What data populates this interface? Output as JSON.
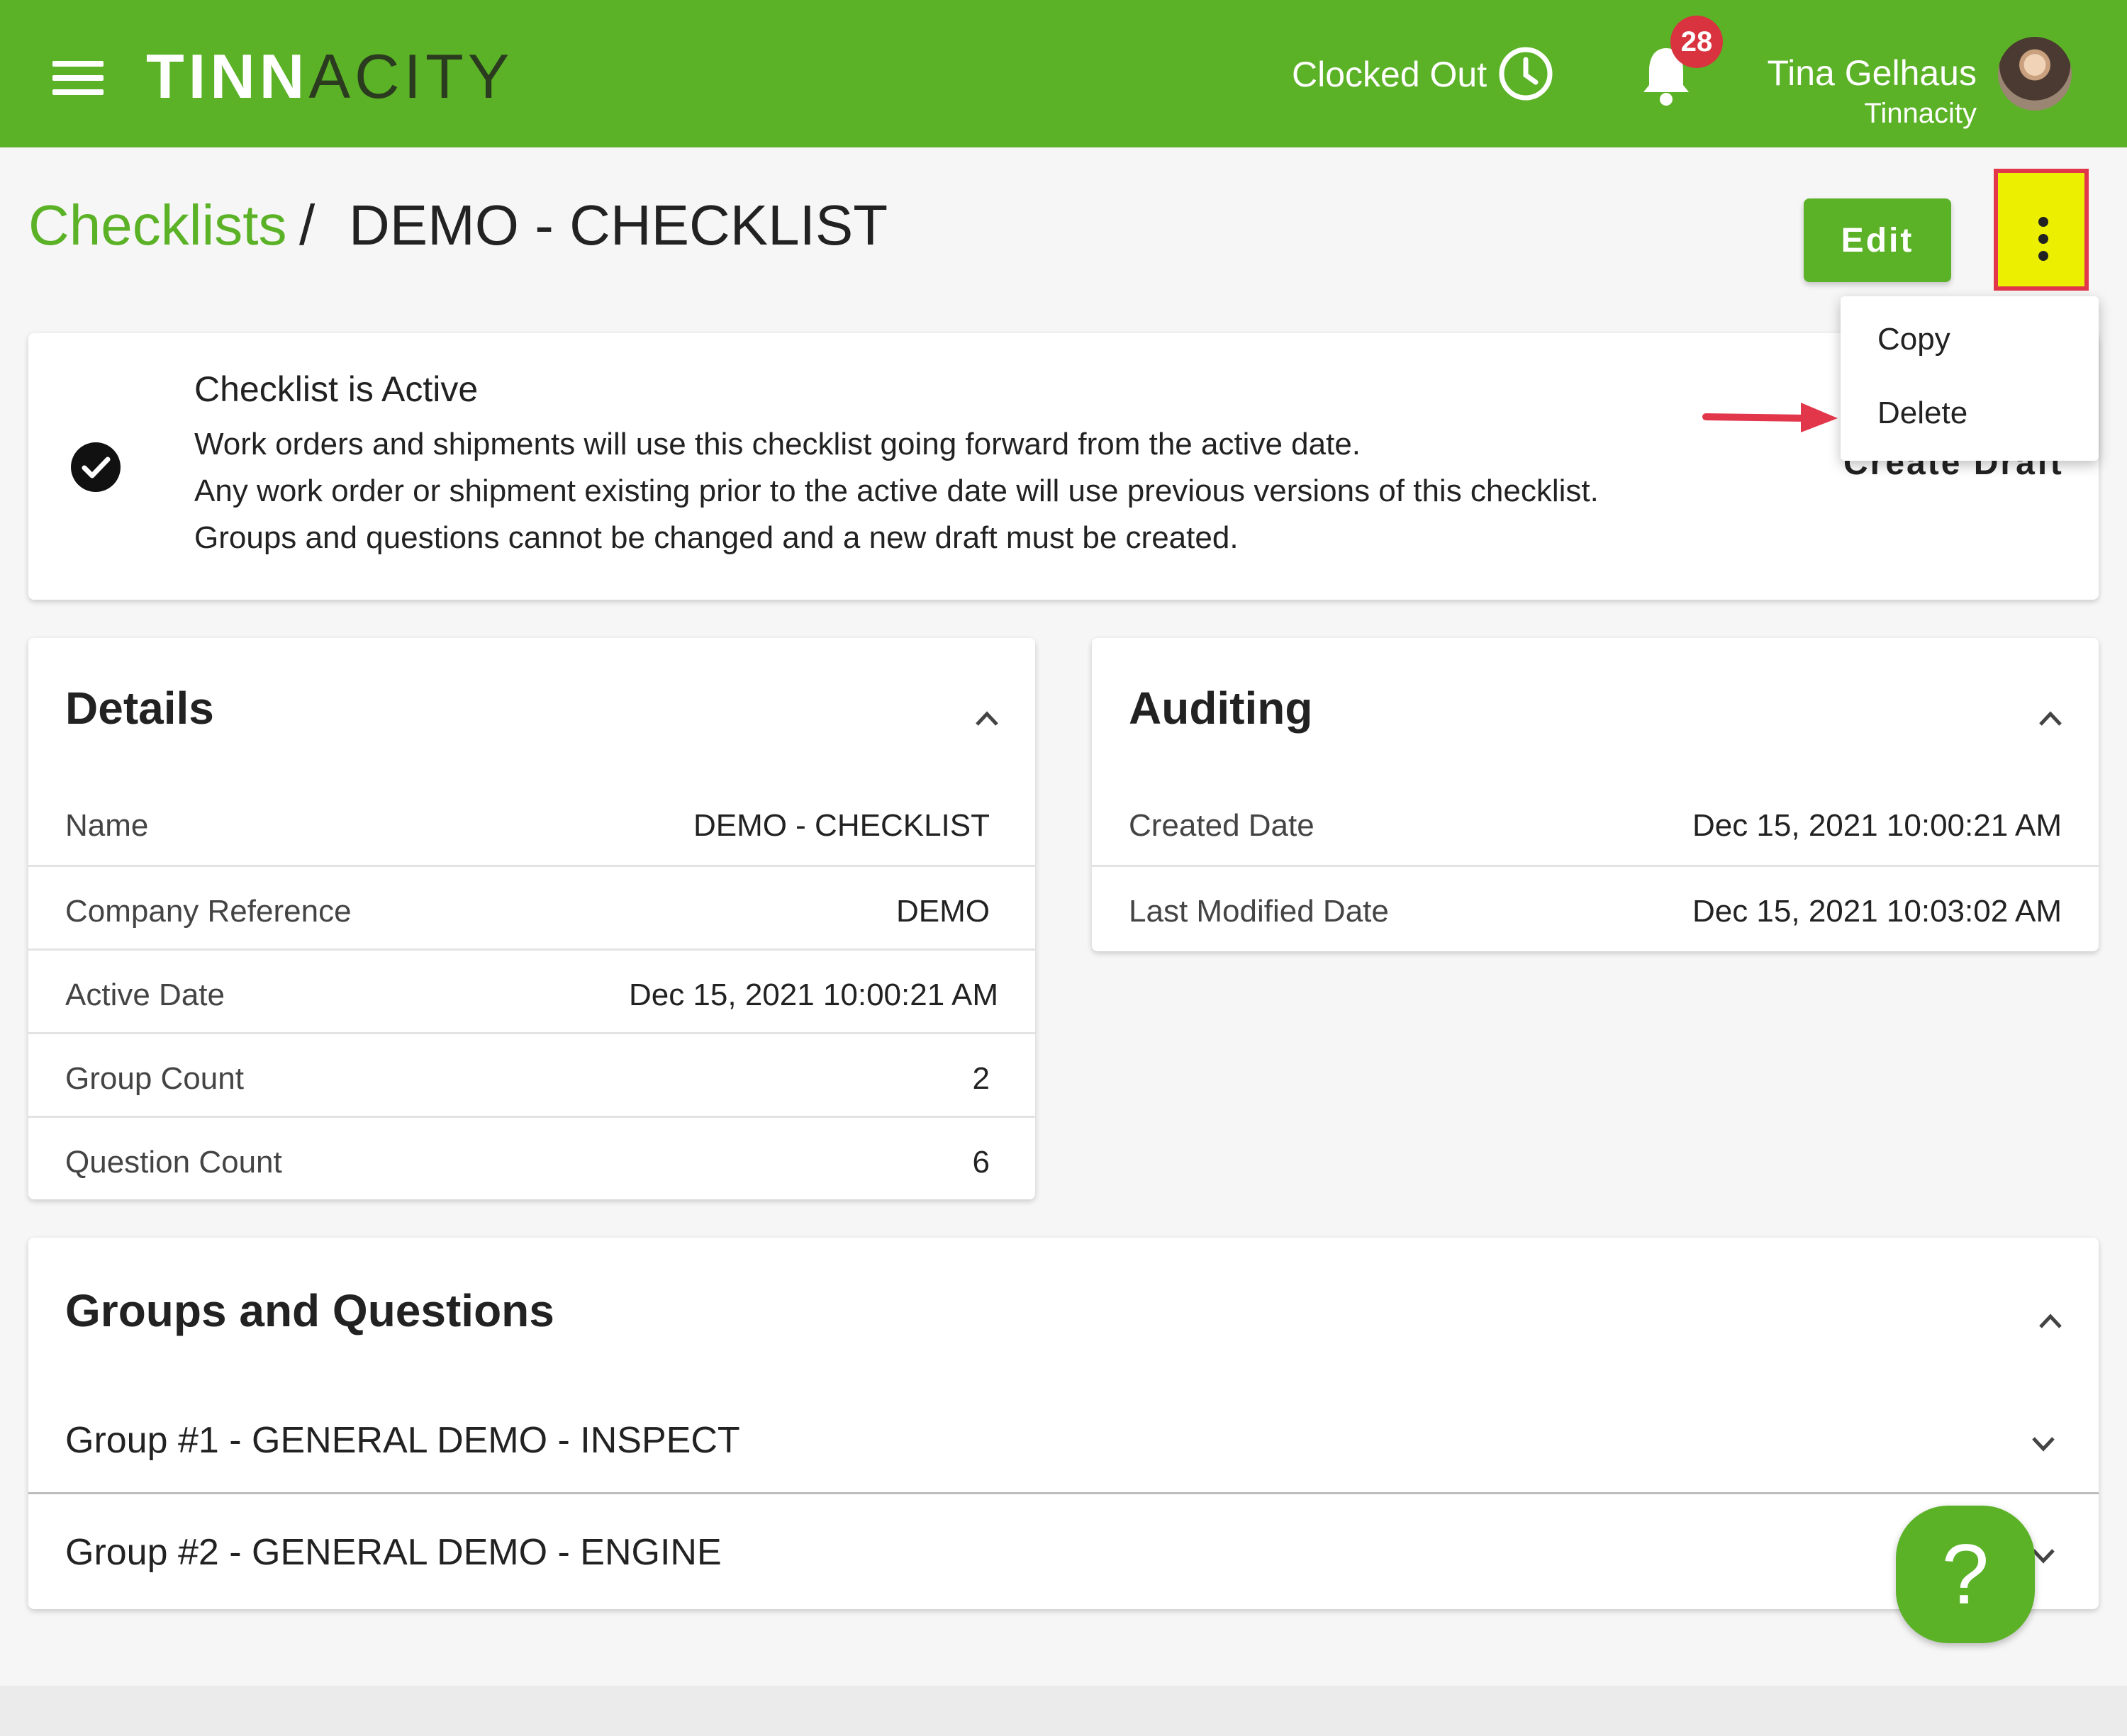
{
  "app": {
    "logo_bold": "TINN",
    "logo_light": "ACITY",
    "logo_tail": ""
  },
  "header": {
    "clock_status": "Clocked Out",
    "notification_count": "28",
    "user_name": "Tina Gelhaus",
    "user_org": "Tinnacity"
  },
  "breadcrumb": {
    "parent": "Checklists",
    "separator": "/",
    "current": "DEMO - CHECKLIST"
  },
  "toolbar": {
    "edit_label": "Edit"
  },
  "menu": {
    "items": [
      "Copy",
      "Delete"
    ]
  },
  "status_card": {
    "title": "Checklist is Active",
    "lines": [
      "Work orders and shipments will use this checklist going forward from the active date.",
      "Any work order or shipment existing prior to the active date will use previous versions of this checklist.",
      "Groups and questions cannot be changed and a new draft must be created."
    ],
    "action_label": "Create Draft"
  },
  "details": {
    "title": "Details",
    "rows": [
      {
        "label": "Name",
        "value": "DEMO - CHECKLIST"
      },
      {
        "label": "Company Reference",
        "value": "DEMO"
      },
      {
        "label": "Active Date",
        "value": "Dec 15, 2021 10:00:21 AM"
      },
      {
        "label": "Group Count",
        "value": "2"
      },
      {
        "label": "Question Count",
        "value": "6"
      }
    ]
  },
  "auditing": {
    "title": "Auditing",
    "rows": [
      {
        "label": "Created Date",
        "value": "Dec 15, 2021 10:00:21 AM"
      },
      {
        "label": "Last Modified Date",
        "value": "Dec 15, 2021 10:03:02 AM"
      }
    ]
  },
  "groups": {
    "title": "Groups and Questions",
    "items": [
      {
        "label": "Group #1 - GENERAL DEMO - INSPECT"
      },
      {
        "label": "Group #2 - GENERAL DEMO - ENGINE"
      }
    ]
  },
  "help": {
    "label": "?"
  },
  "colors": {
    "brand": "#5bb227",
    "badge": "#d9333f",
    "highlight": "#ecf000",
    "annotation": "#e2374b"
  }
}
